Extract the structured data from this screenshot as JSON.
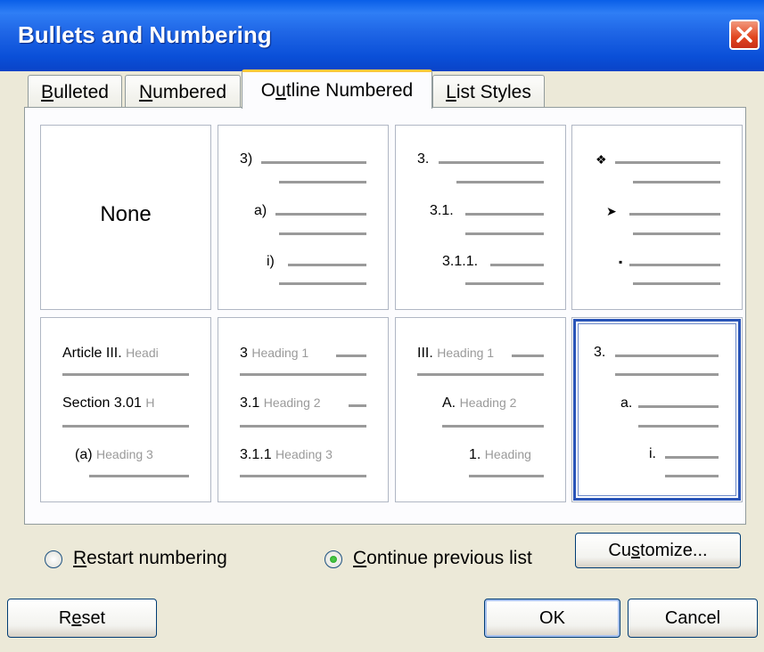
{
  "window": {
    "title": "Bullets and Numbering"
  },
  "tabs": [
    {
      "pre": "",
      "key": "B",
      "post": "ulleted"
    },
    {
      "pre": "",
      "key": "N",
      "post": "umbered"
    },
    {
      "pre": "O",
      "key": "u",
      "post": "tline Numbered"
    },
    {
      "pre": "",
      "key": "L",
      "post": "ist Styles"
    }
  ],
  "gallery": {
    "none_label": "None",
    "cell2": [
      "3)",
      "a)",
      "i)"
    ],
    "cell3": [
      "3.",
      "3.1.",
      "3.1.1."
    ],
    "cell4": [
      "❖",
      "➤",
      "▪"
    ],
    "cell5": [
      {
        "num": "Article III.",
        "heading": "Headi"
      },
      {
        "num": "Section 3.01",
        "heading": "H"
      },
      {
        "num": "(a)",
        "heading": "Heading 3"
      }
    ],
    "cell6": [
      {
        "num": "3",
        "heading": "Heading 1"
      },
      {
        "num": "3.1",
        "heading": "Heading 2"
      },
      {
        "num": "3.1.1",
        "heading": "Heading 3"
      }
    ],
    "cell7": [
      {
        "num": "III.",
        "heading": "Heading 1"
      },
      {
        "num": "A.",
        "heading": "Heading 2"
      },
      {
        "num": "1.",
        "heading": "Heading"
      }
    ],
    "cell8": [
      "3.",
      "a.",
      "i."
    ]
  },
  "options": {
    "restart": {
      "key": "R",
      "post": "estart numbering"
    },
    "continue": {
      "key": "C",
      "post": "ontinue previous list"
    }
  },
  "buttons": {
    "customize": {
      "pre": "Cu",
      "key": "s",
      "post": "tomize..."
    },
    "reset": {
      "pre": "R",
      "key": "e",
      "post": "set"
    },
    "ok": "OK",
    "cancel": "Cancel"
  }
}
